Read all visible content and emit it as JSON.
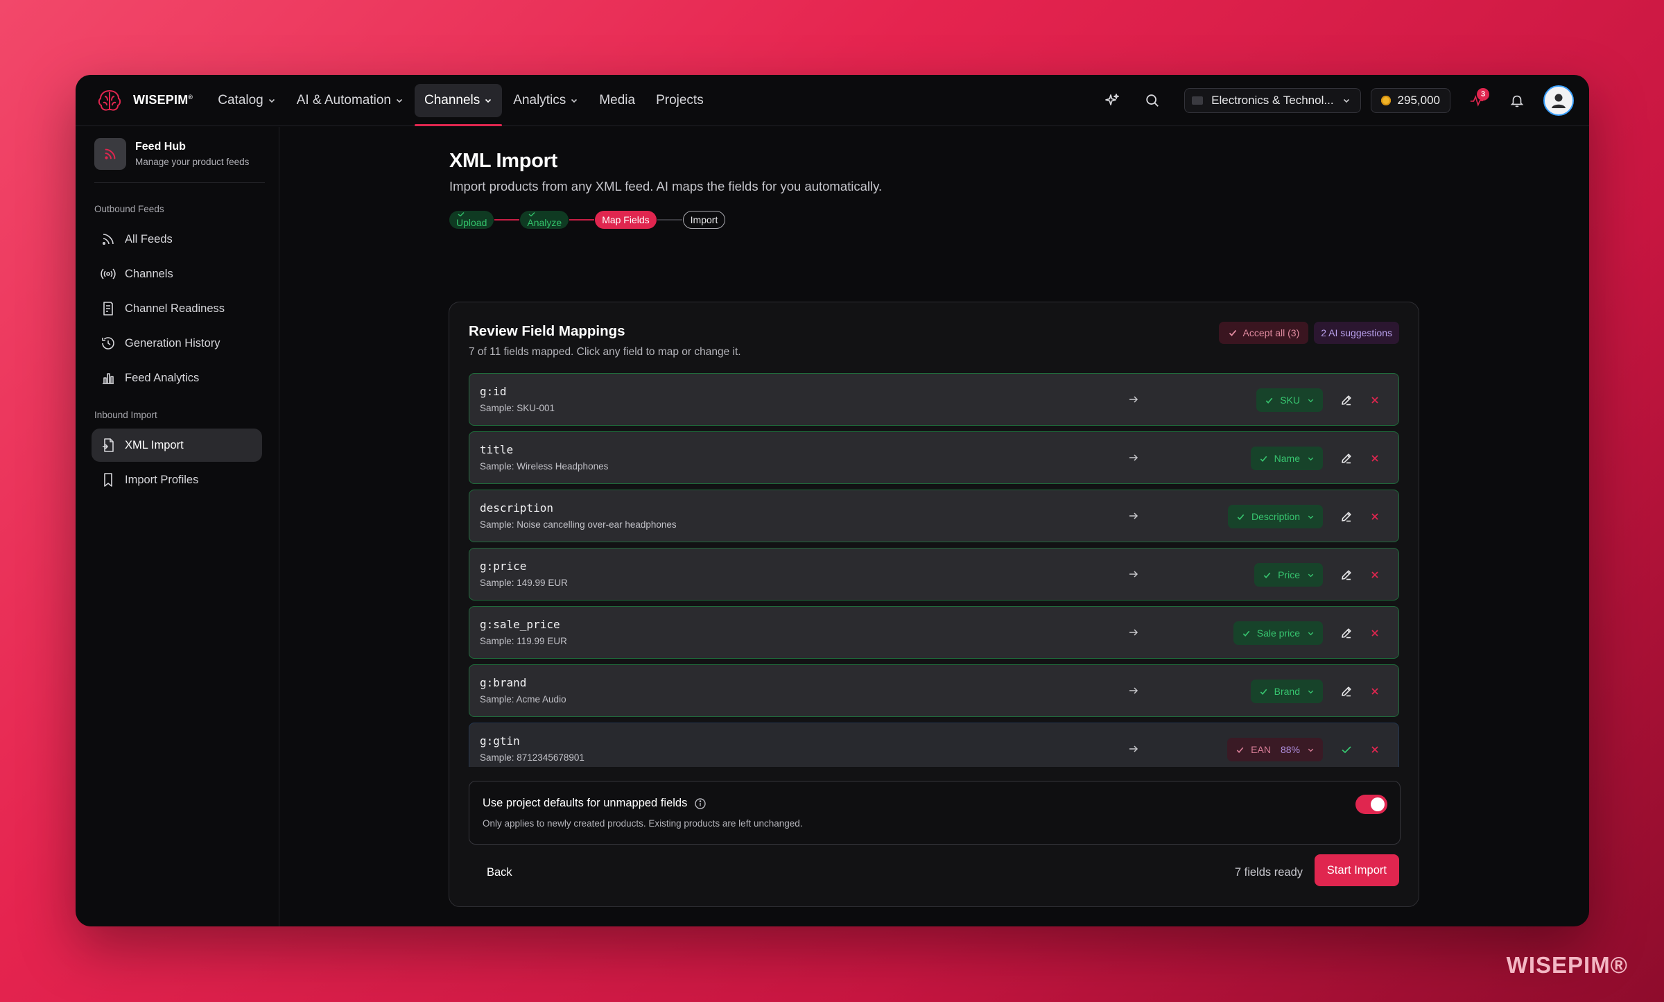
{
  "brand": {
    "name": "WISEPIM",
    "mark": "®",
    "watermark": "WISEPIM®"
  },
  "topnav": {
    "items": [
      {
        "label": "Catalog",
        "dropdown": true
      },
      {
        "label": "AI & Automation",
        "dropdown": true
      },
      {
        "label": "Channels",
        "dropdown": true,
        "active": true
      },
      {
        "label": "Analytics",
        "dropdown": true
      },
      {
        "label": "Media",
        "dropdown": false
      },
      {
        "label": "Projects",
        "dropdown": false
      }
    ],
    "workspace": "Electronics & Technol...",
    "credits": "295,000",
    "activity_count": "3",
    "icons": [
      "sparkles-icon",
      "search-icon",
      "activity-icon",
      "bell-icon",
      "user-icon"
    ]
  },
  "sidebar": {
    "header": {
      "title": "Feed Hub",
      "subtitle": "Manage your product feeds"
    },
    "sections": [
      {
        "title": "Outbound Feeds",
        "items": [
          {
            "label": "All Feeds",
            "icon": "rss-icon"
          },
          {
            "label": "Channels",
            "icon": "broadcast-icon"
          },
          {
            "label": "Channel Readiness",
            "icon": "checklist-icon"
          },
          {
            "label": "Generation History",
            "icon": "history-icon"
          },
          {
            "label": "Feed Analytics",
            "icon": "bar-chart-icon"
          }
        ]
      },
      {
        "title": "Inbound Import",
        "items": [
          {
            "label": "XML Import",
            "icon": "file-import-icon",
            "active": true
          },
          {
            "label": "Import Profiles",
            "icon": "bookmark-icon"
          }
        ]
      }
    ]
  },
  "page": {
    "title": "XML Import",
    "description": "Import products from any XML feed. AI maps the fields for you automatically.",
    "steps": [
      {
        "label": "Upload",
        "state": "done"
      },
      {
        "label": "Analyze",
        "state": "done"
      },
      {
        "label": "Map Fields",
        "state": "current"
      },
      {
        "label": "Import",
        "state": "todo"
      }
    ]
  },
  "card": {
    "title": "Review Field Mappings",
    "subtitle": "7 of 11 fields mapped. Click any field to map or change it.",
    "accept_all": "Accept all (3)",
    "ai_suggestions": "2 AI suggestions",
    "rows": [
      {
        "name": "g:id",
        "sample": "Sample: SKU-001",
        "target": "SKU",
        "state": "mapped"
      },
      {
        "name": "title",
        "sample": "Sample: Wireless Headphones",
        "target": "Name",
        "state": "mapped"
      },
      {
        "name": "description",
        "sample": "Sample: Noise cancelling over-ear headphones",
        "target": "Description",
        "state": "mapped"
      },
      {
        "name": "g:price",
        "sample": "Sample: 149.99 EUR",
        "target": "Price",
        "state": "mapped"
      },
      {
        "name": "g:sale_price",
        "sample": "Sample: 119.99 EUR",
        "target": "Sale price",
        "state": "mapped"
      },
      {
        "name": "g:brand",
        "sample": "Sample: Acme Audio",
        "target": "Brand",
        "state": "mapped"
      },
      {
        "name": "g:gtin",
        "sample": "Sample: 8712345678901",
        "target": "EAN",
        "confidence": "88%",
        "state": "suggested"
      }
    ],
    "defaults": {
      "title": "Use project defaults for unmapped fields",
      "subtitle": "Only applies to newly created products. Existing products are left unchanged.",
      "enabled": true
    },
    "back_label": "Back",
    "ready_label": "7 fields ready",
    "start_label": "Start Import"
  },
  "colors": {
    "accent": "#e0264f",
    "success": "#37c46f",
    "ai": "#b090e0"
  }
}
